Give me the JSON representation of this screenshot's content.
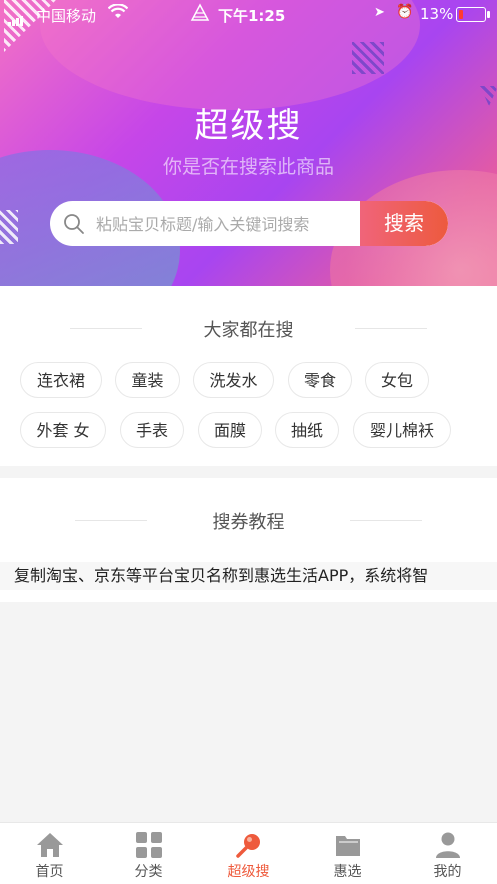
{
  "status_bar": {
    "carrier": "中国移动",
    "time": "下午1:25",
    "battery": "13%"
  },
  "hero": {
    "title": "超级搜",
    "subtitle": "你是否在搜索此商品"
  },
  "search": {
    "placeholder": "粘贴宝贝标题/输入关键词搜索",
    "button_label": "搜索"
  },
  "hot_searches": {
    "heading": "大家都在搜",
    "tags": [
      "连衣裙",
      "童装",
      "洗发水",
      "零食",
      "女包",
      "外套 女",
      "手表",
      "面膜",
      "抽纸",
      "婴儿棉袄"
    ]
  },
  "tutorial": {
    "heading": "搜券教程",
    "text": "复制淘宝、京东等平台宝贝名称到惠选生活APP，系统将智"
  },
  "tabbar": {
    "items": [
      {
        "label": "首页",
        "icon": "home-icon"
      },
      {
        "label": "分类",
        "icon": "grid-icon"
      },
      {
        "label": "超级搜",
        "icon": "search-icon",
        "active": true
      },
      {
        "label": "惠选",
        "icon": "folder-icon"
      },
      {
        "label": "我的",
        "icon": "user-icon"
      }
    ]
  },
  "colors": {
    "accent": "#ee5a3c",
    "hero_gradient_start": "#f472c4",
    "hero_gradient_end": "#a845f0"
  }
}
